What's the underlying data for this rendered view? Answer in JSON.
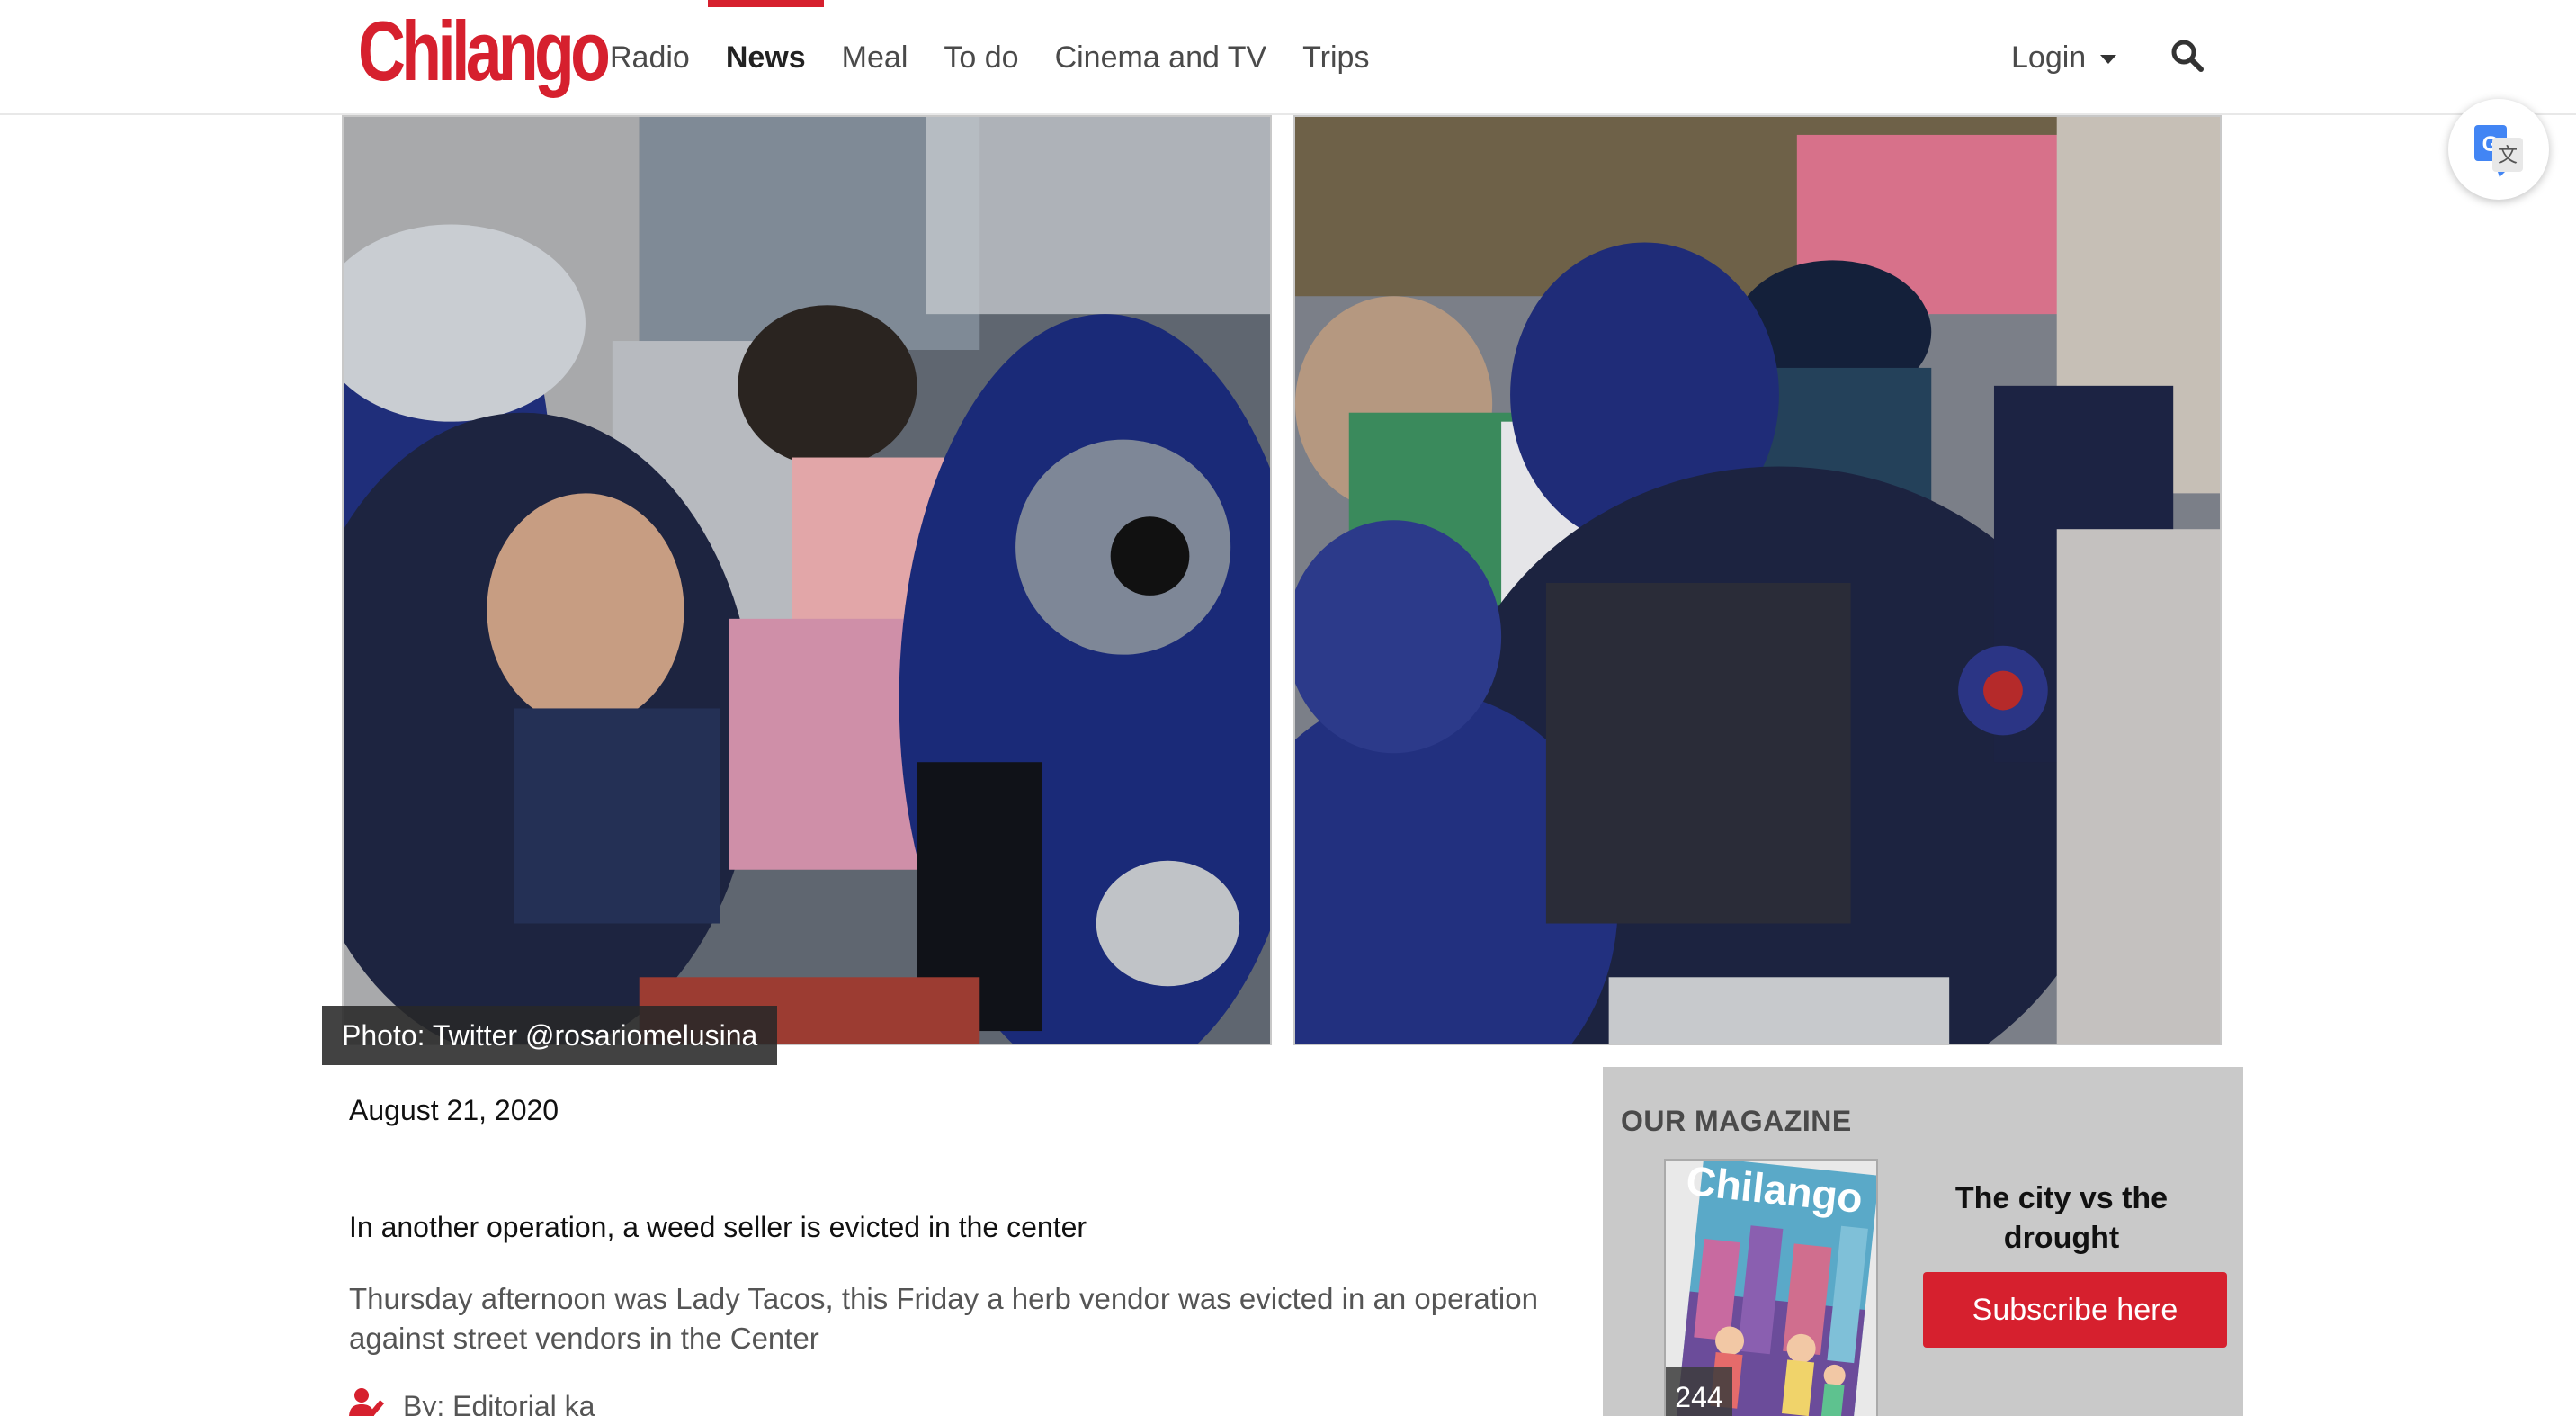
{
  "header": {
    "logo_text": "Chilango",
    "nav": [
      {
        "label": "Radio",
        "active": false
      },
      {
        "label": "News",
        "active": true
      },
      {
        "label": "Meal",
        "active": false
      },
      {
        "label": "To do",
        "active": false
      },
      {
        "label": "Cinema and TV",
        "active": false
      },
      {
        "label": "Trips",
        "active": false
      }
    ],
    "login_label": "Login",
    "icons": {
      "search": "search-icon",
      "login_dropdown": "chevron-down-icon",
      "translate": "google-translate-icon"
    }
  },
  "hero": {
    "caption": "Photo: Twitter @rosariomelusina",
    "images": [
      "police-eviction-photo-left",
      "police-eviction-photo-right"
    ]
  },
  "article": {
    "date": "August 21, 2020",
    "headline": "In another operation, a weed seller is evicted in the center",
    "summary": "Thursday afternoon was Lady Tacos, this Friday a herb vendor was evicted in an operation against street vendors in the Center",
    "byline": "By: Editorial ka"
  },
  "magazine": {
    "section_title": "OUR MAGAZINE",
    "cover_logo": "Chilango",
    "issue_number": "244",
    "tagline": "The city vs the drought",
    "subscribe_label": "Subscribe here"
  },
  "colors": {
    "brand_red": "#d6202e",
    "aside_bg": "#c9c9c9",
    "caption_bg": "#282828"
  }
}
